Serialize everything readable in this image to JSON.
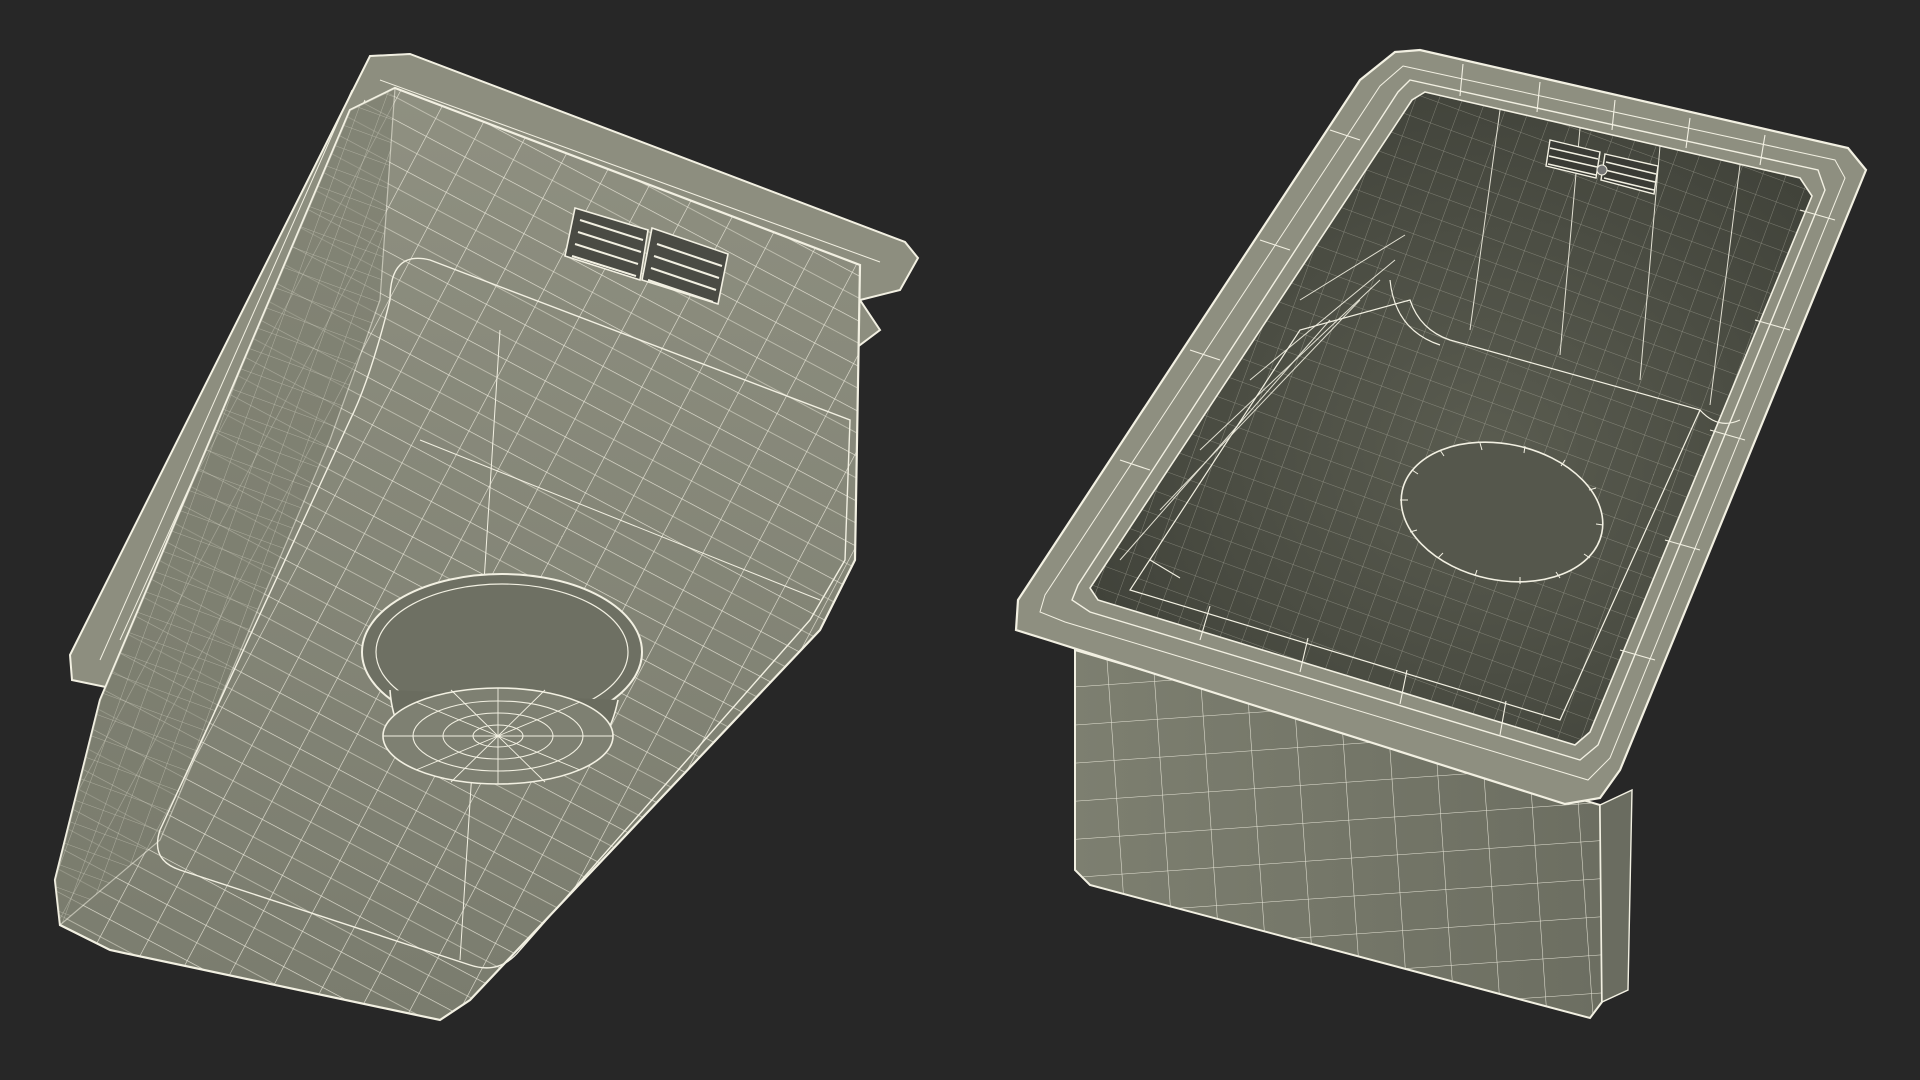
{
  "scene": {
    "background_color": "#272727",
    "surface_color": "#8a8b7c",
    "surface_dark_color": "#62645a",
    "interior_color": "#4a4c42",
    "wire_color": "#f2f0e2"
  },
  "views": [
    {
      "name": "sink-bottom-view",
      "description_visible": false
    },
    {
      "name": "sink-top-view",
      "description_visible": false
    }
  ]
}
